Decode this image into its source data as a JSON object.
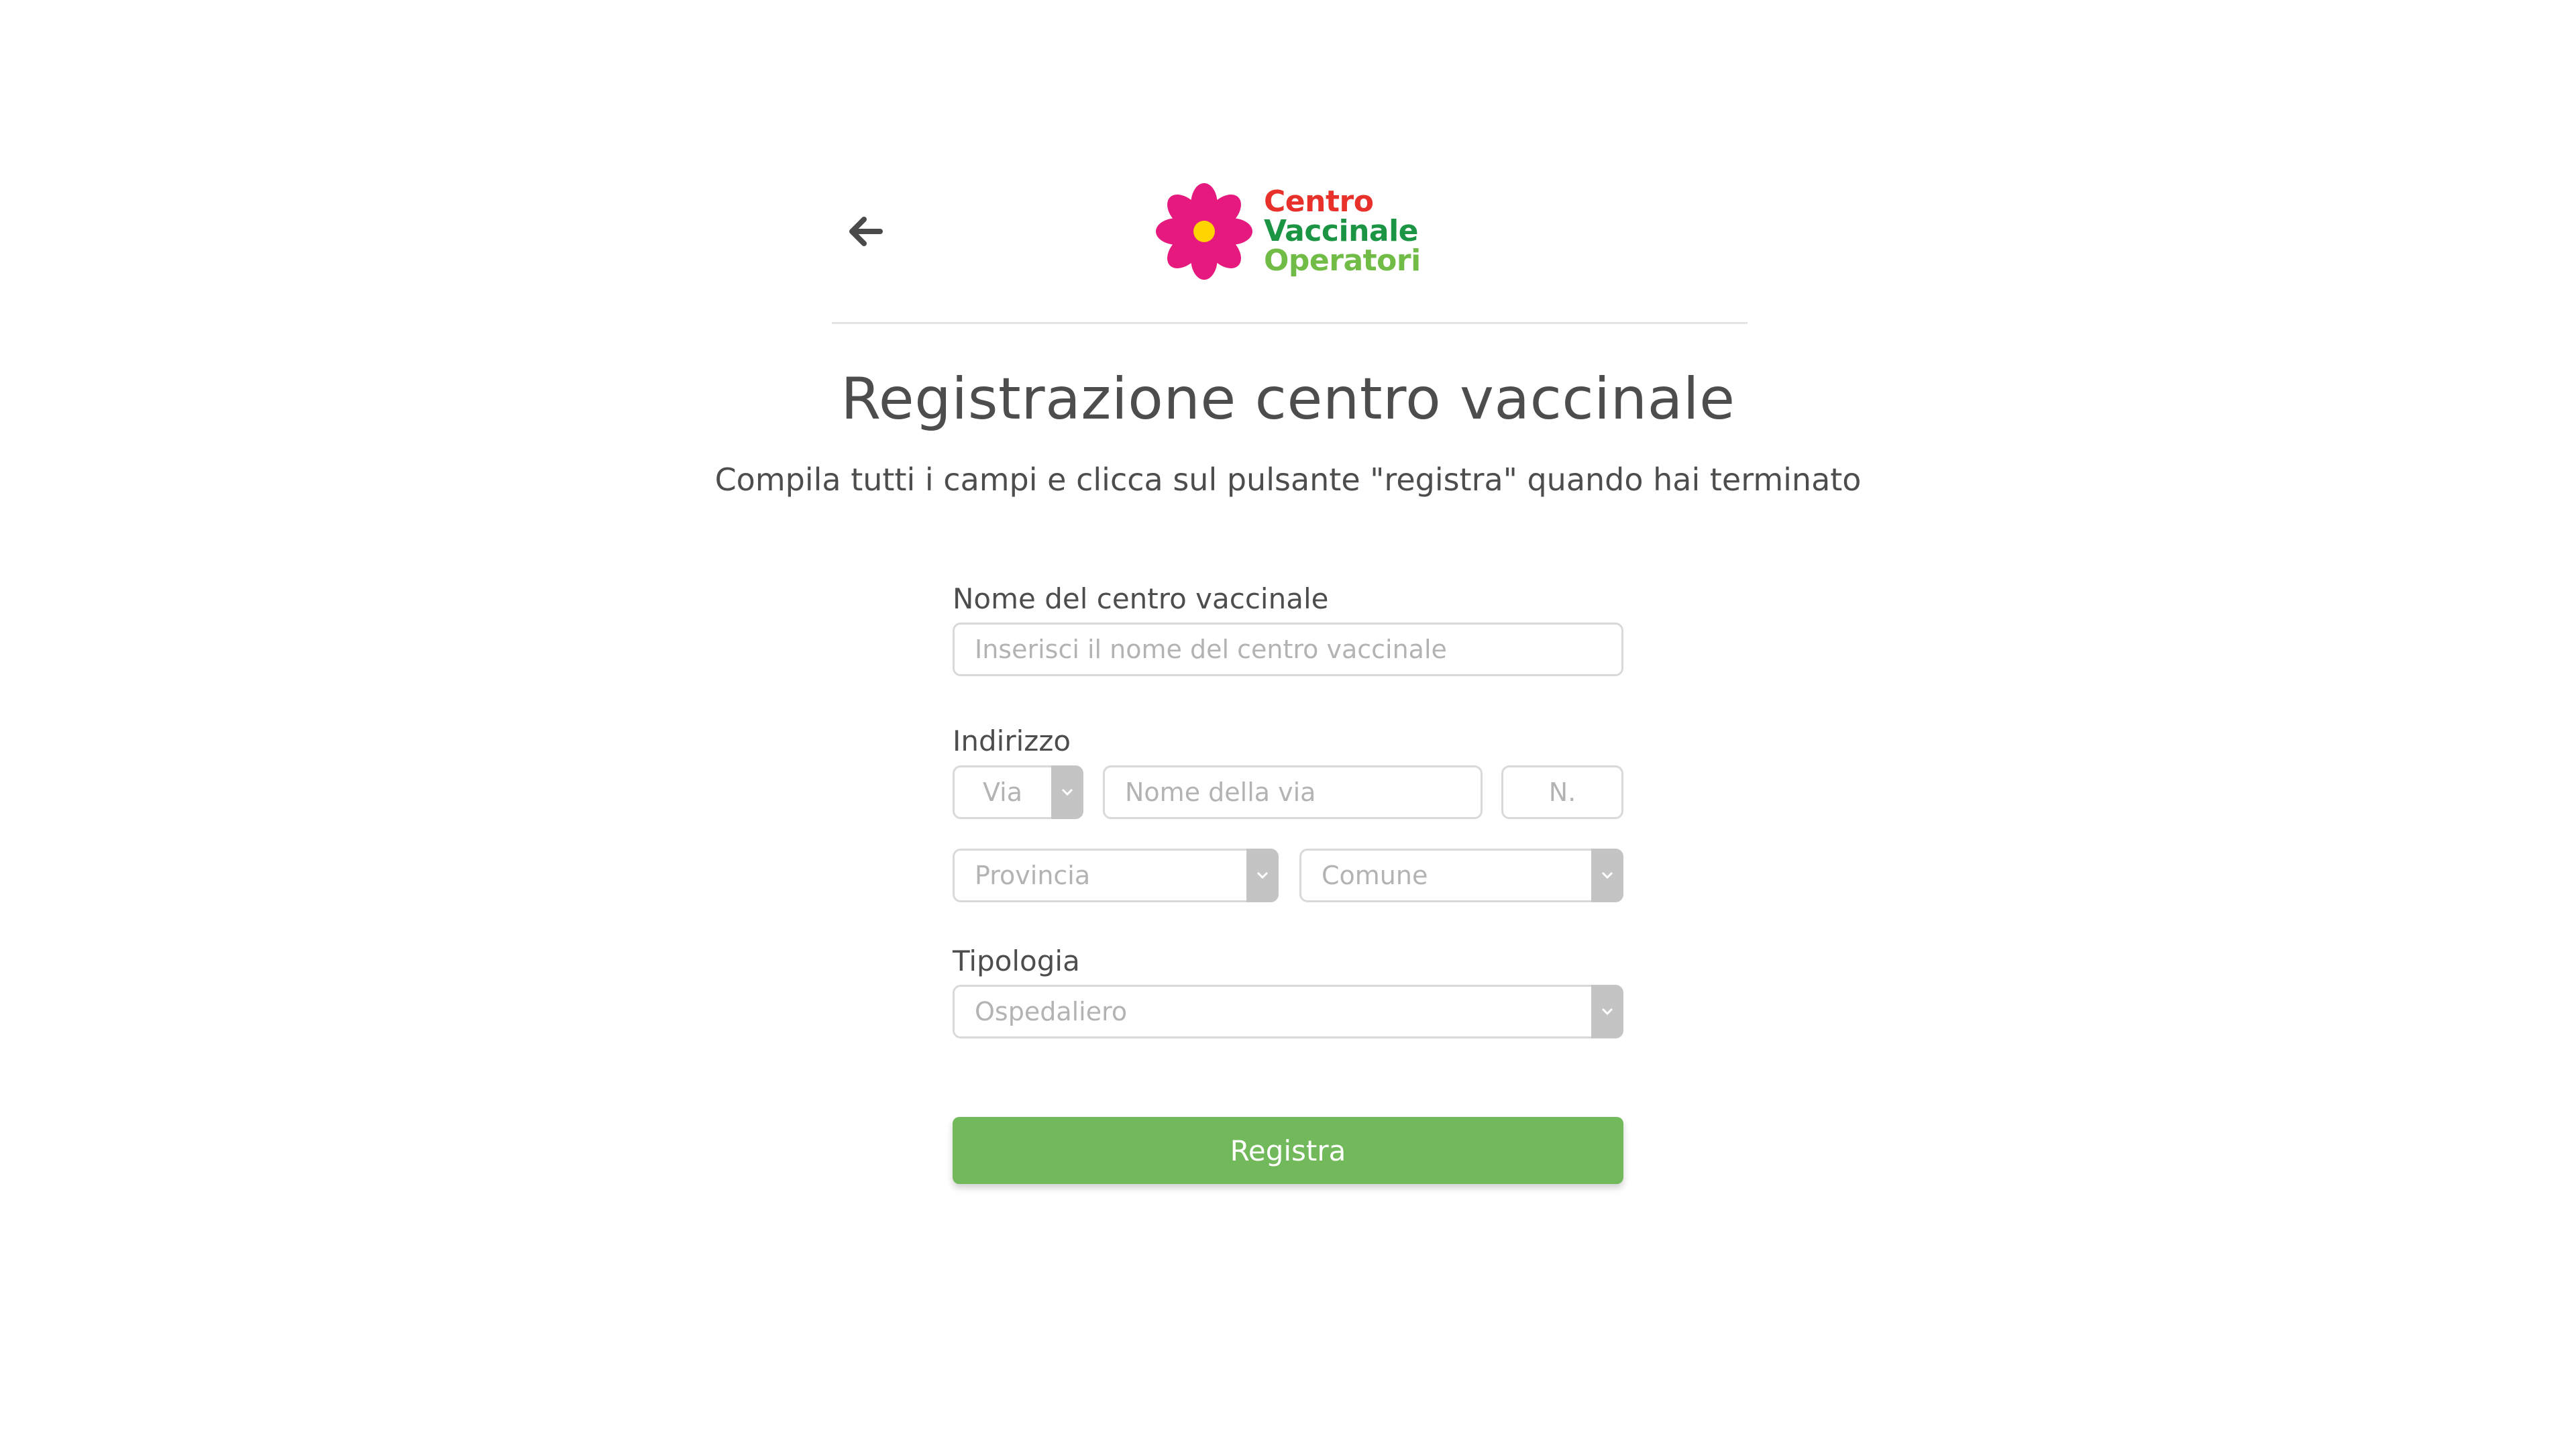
{
  "header": {
    "logo": {
      "line1": "Centro",
      "line2": "Vaccinale",
      "line3": "Operatori"
    },
    "back_icon": "arrow-left-icon"
  },
  "page": {
    "title": "Registrazione centro vaccinale",
    "subtitle": "Compila tutti i campi e clicca sul pulsante \"registra\" quando hai terminato"
  },
  "form": {
    "name": {
      "label": "Nome del centro vaccinale",
      "placeholder": "Inserisci il nome del centro vaccinale"
    },
    "address": {
      "label": "Indirizzo",
      "street_type": "Via",
      "street_name_placeholder": "Nome della via",
      "number_placeholder": "N.",
      "province": "Provincia",
      "municipality": "Comune"
    },
    "type": {
      "label": "Tipologia",
      "value": "Ospedaliero"
    },
    "submit_label": "Registra"
  },
  "colors": {
    "logo_red": "#e8312b",
    "logo_dark_green": "#1b9444",
    "logo_light_green": "#70bc46",
    "flower_petals": "#e6197f",
    "flower_center": "#ffd400",
    "button_green": "#72b95b"
  }
}
